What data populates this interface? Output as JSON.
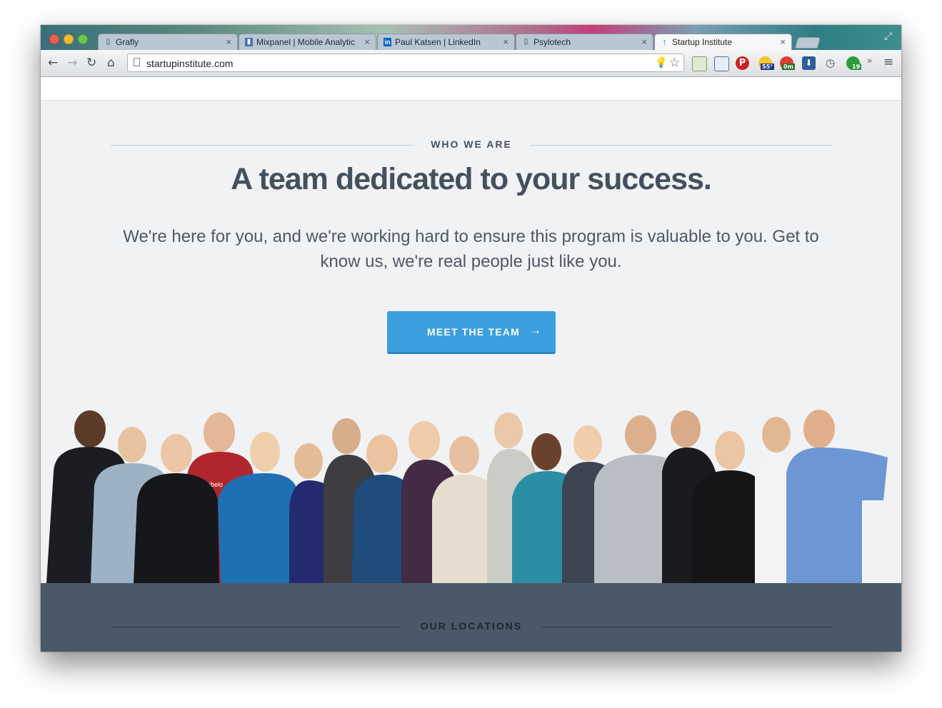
{
  "browser": {
    "tabs": [
      {
        "label": "Grafly",
        "icon": "page-icon"
      },
      {
        "label": "Mixpanel | Mobile Analytic",
        "icon": "mixpanel-icon"
      },
      {
        "label": "Paul Katsen | LinkedIn",
        "icon": "linkedin-icon"
      },
      {
        "label": "Psylotech",
        "icon": "page-icon"
      },
      {
        "label": "Startup Institute",
        "icon": "startup-institute-icon"
      }
    ],
    "active_tab": 4,
    "url": "startupinstitute.com",
    "extensions": {
      "weather_badge": "55°",
      "timer_badge": "0m",
      "counter_badge": "19",
      "overflow": "»"
    }
  },
  "page": {
    "eyebrow": "WHO WE ARE",
    "headline": "A team dedicated to your success.",
    "lead": "We're here for you, and we're working hard to ensure this program is valuable to you. Get to know us, we're real people just like you.",
    "cta_label": "MEET THE TEAM",
    "cta_arrow": "→",
    "team_photo_shirt_text": "ibelo",
    "footer_eyebrow": "OUR LOCATIONS"
  },
  "colors": {
    "cta": "#3b9fde",
    "footer": "#4a5968",
    "page_bg": "#f1f2f4",
    "text": "#44505d"
  }
}
